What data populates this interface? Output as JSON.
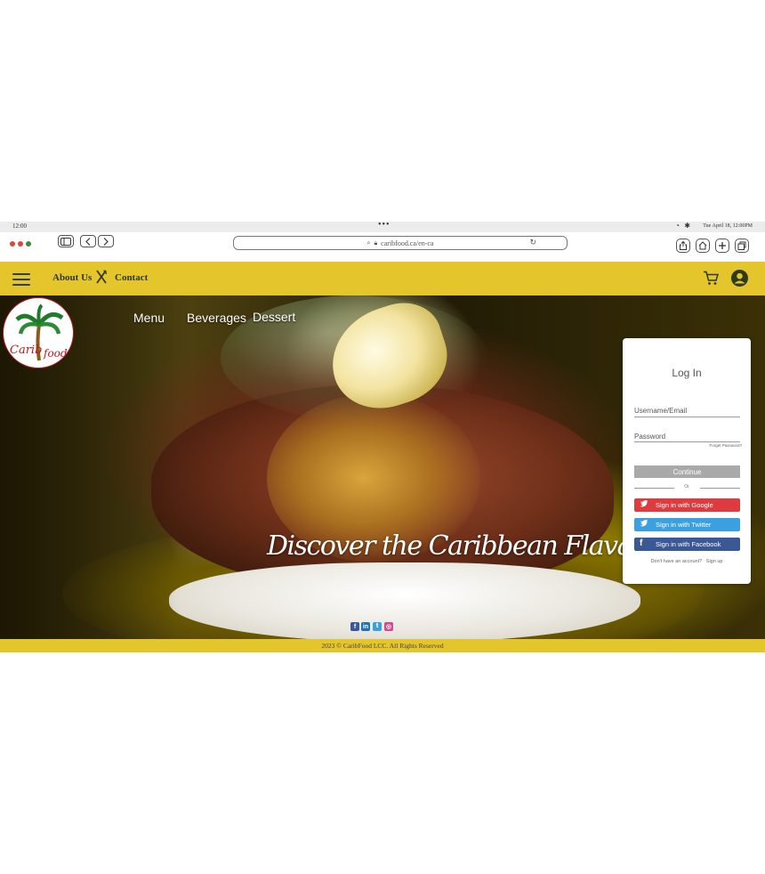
{
  "status_bar": {
    "time": "12:00",
    "center_dots": "•••",
    "datetime": "Tue April 18, 12:00PM"
  },
  "browser": {
    "url": "caribfood.ca/en-ca",
    "traffic_colors": [
      "#e0443a",
      "#e0443a",
      "#3a8e3a"
    ]
  },
  "nav": {
    "about_label": "About Us",
    "contact_label": "Contact",
    "bg_color": "#e5c52c"
  },
  "logo": {
    "text_left": "Carib",
    "text_right": "food"
  },
  "hero": {
    "menu_items": [
      "Menu",
      "Beverages",
      "Dessert"
    ],
    "headline": "Discover the Caribbean Flava",
    "social_icons": [
      "facebook-icon",
      "linkedin-icon",
      "twitter-icon",
      "instagram-icon"
    ]
  },
  "login": {
    "title": "Log In",
    "username_placeholder": "Username/Email",
    "password_placeholder": "Password",
    "forgot": "Forget Password?",
    "continue": "Continue",
    "or": "Or",
    "google": "Sign in with Google",
    "twitter": "Sign in with Twitter",
    "facebook": "Sign in with Facebook",
    "no_account": "Don't have an account?",
    "signup": "Sign up",
    "colors": {
      "google": "#dd3b3f",
      "twitter": "#3aa0e0",
      "facebook": "#3a5896"
    }
  },
  "footer": {
    "text": "2023 © CaribFood LCC. All Rights Reserved"
  }
}
